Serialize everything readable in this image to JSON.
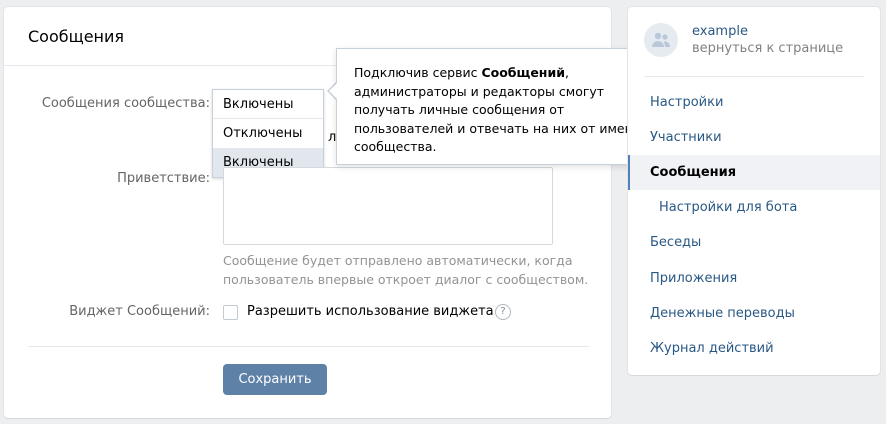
{
  "main": {
    "title": "Сообщения",
    "messages_label": "Сообщения сообщества:",
    "dropdown": {
      "current": "Включены",
      "options": [
        "Отключены",
        "Включены"
      ]
    },
    "hidden_tail": "л",
    "greeting_label": "Приветствие:",
    "greeting_hint": "Сообщение будет отправлено автоматически, когда пользователь впервые откроет диалог с сообществом.",
    "widget_label": "Виджет Сообщений:",
    "widget_checkbox_label": "Разрешить использование виджета",
    "help_icon_glyph": "?",
    "save_label": "Сохранить"
  },
  "tooltip": {
    "prefix": "Подключив сервис ",
    "bold": "Сообщений",
    "suffix": ", администраторы и редакторы смогут получать личные сообщения от пользователей и отвечать на них от имени сообщества."
  },
  "sidebar": {
    "community_name": "example",
    "back_link": "вернуться к странице",
    "items": [
      {
        "label": "Настройки"
      },
      {
        "label": "Участники"
      },
      {
        "label": "Сообщения"
      },
      {
        "label": "Настройки для бота"
      },
      {
        "label": "Беседы"
      },
      {
        "label": "Приложения"
      },
      {
        "label": "Денежные переводы"
      },
      {
        "label": "Журнал действий"
      }
    ]
  },
  "colors": {
    "accent": "#5e81a8",
    "link": "#2a5885",
    "active_border": "#5181b8"
  }
}
